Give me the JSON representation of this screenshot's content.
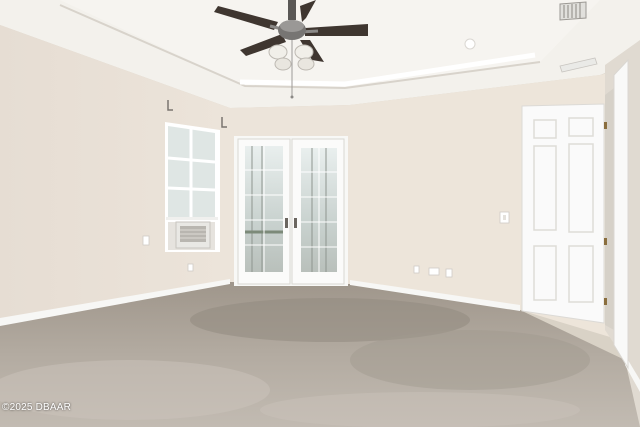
{
  "watermark": {
    "text": "©2025 DBAAR"
  },
  "colors": {
    "ceiling": "#f3f1ec",
    "wall_left": "#e8e0d6",
    "wall_back": "#ede5da",
    "wall_right": "#e3ddd4",
    "carpet": "#b3aba1",
    "trim": "#f7f7f5"
  },
  "icons": [
    "ceiling-fan-icon",
    "air-vent-icon",
    "light-switch-icon",
    "power-outlet-icon"
  ]
}
